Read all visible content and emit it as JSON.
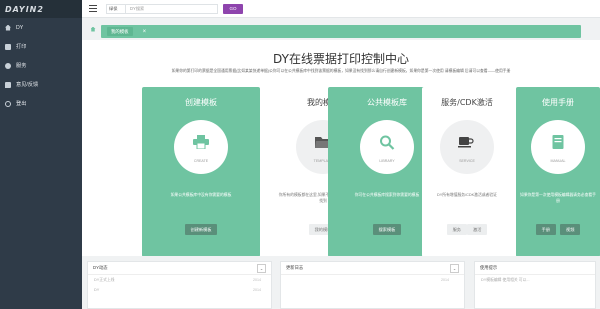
{
  "brand": {
    "logo_text": "DAYIN2"
  },
  "sidebar": {
    "items": [
      {
        "label": "DY",
        "icon": "home-icon"
      },
      {
        "label": "打印",
        "icon": "printer-icon"
      },
      {
        "label": "服务",
        "icon": "service-icon"
      },
      {
        "label": "意见/反馈",
        "icon": "feedback-icon"
      },
      {
        "label": "登出",
        "icon": "logout-icon"
      }
    ]
  },
  "topbar": {
    "select_value": "绿保",
    "search_placeholder": "DY搜索",
    "go_label": "GO"
  },
  "tabs": {
    "active_label": "我的模板",
    "close_glyph": "×"
  },
  "main": {
    "title": "DY在线票据打印控制中心",
    "description": "如果你的第打印的票据是全国通用票据(比如某某快递单据)公你可以在公共模板库中找到该票据的模板，如果没有找到那么请自行创建新模板，如果你是第一次使用 请模板编辑 后请可以查看——使用手册"
  },
  "cards": [
    {
      "title": "创建模板",
      "caption": "CREATE",
      "icon": "printer-icon",
      "text": "如果公共模板库中没有你需要的模板",
      "buttons": [
        "创建新模板"
      ],
      "style": "green"
    },
    {
      "title": "我的模板",
      "caption": "TEMPLATE",
      "icon": "folder-icon",
      "text": "你所有的模板都在这里,如果不你需要可以在这里中查找到",
      "buttons": [
        "我的模板"
      ],
      "style": "white"
    },
    {
      "title": "公共模板库",
      "caption": "LIBRARY",
      "icon": "search-icon",
      "text": "你可在公共模板库搜索到你需要的模板",
      "buttons": [
        "搜索模板"
      ],
      "style": "green"
    },
    {
      "title": "服务/CDK激活",
      "caption": "SERVICE",
      "icon": "coffee-icon",
      "text": "DY所有增值服务/CDK激活或者验证",
      "buttons": [
        "服务",
        "激活"
      ],
      "style": "white"
    },
    {
      "title": "使用手册",
      "caption": "MANUAL",
      "icon": "book-icon",
      "text": "如果你是第一次使用模板编辑器请务必查看手册",
      "buttons": [
        "手册",
        "视频"
      ],
      "style": "green"
    }
  ],
  "panels": [
    {
      "title": "DY动态",
      "rows": [
        {
          "text": "DY正式上线",
          "meta": "2014"
        },
        {
          "text": "DY",
          "meta": "2014"
        }
      ]
    },
    {
      "title": "更新日志",
      "rows": [
        {
          "text": "",
          "meta": "2014"
        }
      ]
    },
    {
      "title": "使用提示",
      "rows": [
        {
          "text": "DY模板编辑 使用相关 可以...",
          "meta": ""
        }
      ]
    }
  ],
  "colors": {
    "accent_green": "#6fc4a1",
    "sidebar": "#2f3b48",
    "go_purple": "#8e44ad"
  }
}
